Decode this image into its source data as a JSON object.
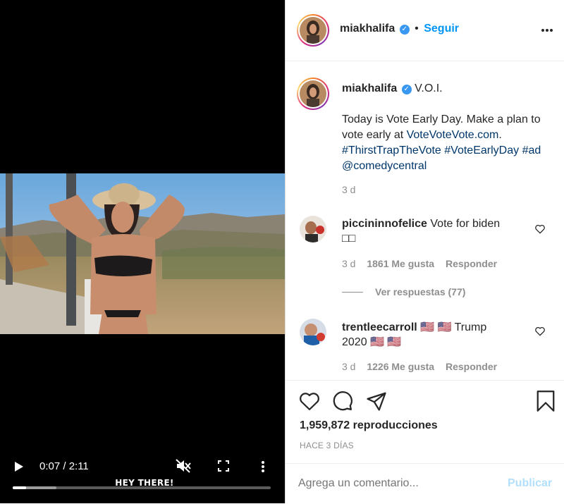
{
  "video": {
    "caption_overlay": "HEY THERE!",
    "time_display": "0:07 / 2:11",
    "progress_played": 0.053,
    "progress_buffered": 0.17,
    "icons": [
      "play-icon",
      "mute-icon",
      "fullscreen-icon",
      "more-vertical-icon"
    ]
  },
  "header": {
    "username": "miakhalifa",
    "separator": "•",
    "follow_label": "Seguir",
    "more_icon": "more-horizontal-icon"
  },
  "post": {
    "username": "miakhalifa",
    "location": "V.O.I.",
    "text_before_link": "Today is Vote Early Day. Make a plan to vote early at ",
    "link": "VoteVoteVote.com",
    "text_after_link": ".",
    "hashtag1": "#ThirstTrapTheVote",
    "hashtag2": "#VoteEarlyDay",
    "hashtag3": "#ad",
    "mention": "@comedycentral",
    "time": "3 d"
  },
  "comments": [
    {
      "username": "piccininnofelice",
      "text": "Vote for biden",
      "text2": "□□",
      "time": "3 d",
      "likes": "1861 Me gusta",
      "reply": "Responder",
      "view_replies": "Ver respuestas (77)"
    },
    {
      "username": "trentleecarroll",
      "text_line1": "🇺🇸 🇺🇸 Trump",
      "text_line2": "2020 🇺🇸 🇺🇸",
      "time": "3 d",
      "likes": "1226 Me gusta",
      "reply": "Responder"
    }
  ],
  "actions": {
    "icons": [
      "heart-icon",
      "comment-icon",
      "share-icon",
      "bookmark-icon"
    ],
    "views": "1,959,872 reproducciones",
    "posted": "HACE 3 DÍAS"
  },
  "add_comment": {
    "placeholder": "Agrega un comentario...",
    "publish_label": "Publicar"
  },
  "colors": {
    "accent": "#0095f6",
    "link": "#00376b",
    "muted": "#8e8e8e",
    "publish_disabled": "#b2dffc",
    "verified": "#3897f0"
  }
}
